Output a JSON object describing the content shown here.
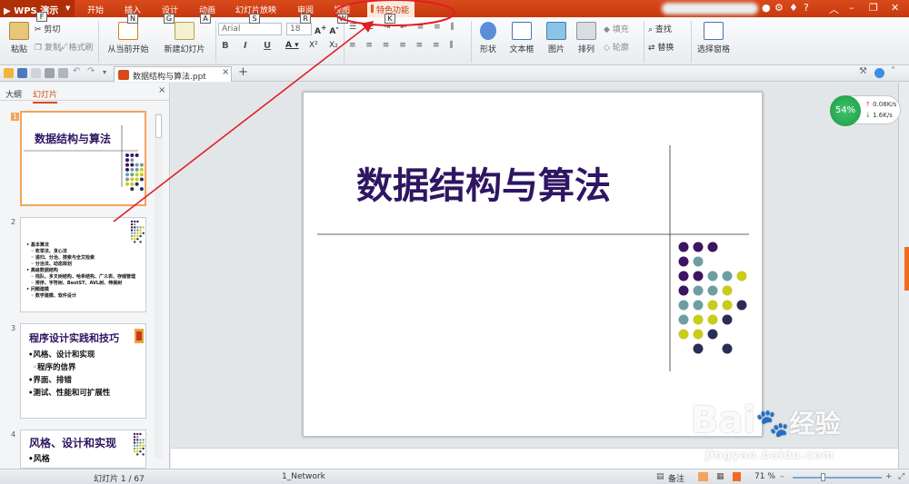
{
  "app": {
    "name": "WPS 演示"
  },
  "tabs": [
    {
      "label": "开始",
      "key": "F"
    },
    {
      "label": "插入",
      "key": "N"
    },
    {
      "label": "设计",
      "key": "G"
    },
    {
      "label": "动画",
      "key": "A"
    },
    {
      "label": "幻灯片放映",
      "key": "S"
    },
    {
      "label": "审阅",
      "key": "R"
    },
    {
      "label": "视图",
      "key": "W"
    },
    {
      "label": "特色功能",
      "key": "K"
    }
  ],
  "ribbon": {
    "paste": "粘贴",
    "cut": "剪切",
    "copy": "复制",
    "format_painter": "格式刷",
    "from_current": "从当前开始",
    "new_slide": "新建幻灯片",
    "font": "Arial",
    "font_size": "18",
    "bold": "B",
    "italic": "I",
    "underline": "U",
    "shape": "形状",
    "textbox": "文本框",
    "picture": "图片",
    "arrange": "排列",
    "fill": "填充",
    "outline": "轮廓",
    "find": "查找",
    "replace": "替换",
    "select_pane": "选择窗格"
  },
  "document": {
    "tab": "数据结构与算法.ppt"
  },
  "panel": {
    "tab_outline": "大纲",
    "tab_slides": "幻灯片",
    "close": "×"
  },
  "thumbnails": [
    {
      "num": "1",
      "title": "数据结构与算法"
    },
    {
      "num": "2",
      "lines": [
        "• 基本算法",
        "◦ 枚举法、贪心法",
        "◦ 递归、分治、搜索与全文检索",
        "◦ 分治法、动态规划",
        "• 高级数据结构",
        "◦ 栈队、多叉树结构、哈希结构、广义表、存储管理",
        "◦ 排序、字符树、BestST、AVL树、伸展树",
        "• 问题建模",
        "◦ 数学建模、软件设计"
      ]
    },
    {
      "num": "3",
      "title": "程序设计实践和技巧",
      "lines": [
        "•风格、设计和实现",
        "◦程序的信界",
        "•界面、排错",
        "•测试、性能和可扩展性"
      ]
    },
    {
      "num": "4",
      "title": "风格、设计和实现",
      "lines": [
        "•风格"
      ]
    }
  ],
  "slide": {
    "title": "数据结构与算法"
  },
  "gauge": {
    "percent": "54%",
    "up": "0.08K/s",
    "down": "1.6K/s"
  },
  "status": {
    "slide_count": "幻灯片 1 / 67",
    "theme": "1_Network",
    "notes": "备注",
    "zoom": "71 %"
  },
  "colors": {
    "titlebar": "#d84a1b",
    "accent": "#f26b21",
    "slide_title": "#2e1662",
    "dot_purple": "#3d1460",
    "dot_teal": "#6f9ea1",
    "dot_yellow": "#c8cc1a",
    "dot_navy": "#2c2c58",
    "annotation": "#e31e24"
  },
  "watermark": {
    "brand": "Bai",
    "brand2": "经验",
    "url": "jingyan.baidu.com"
  }
}
